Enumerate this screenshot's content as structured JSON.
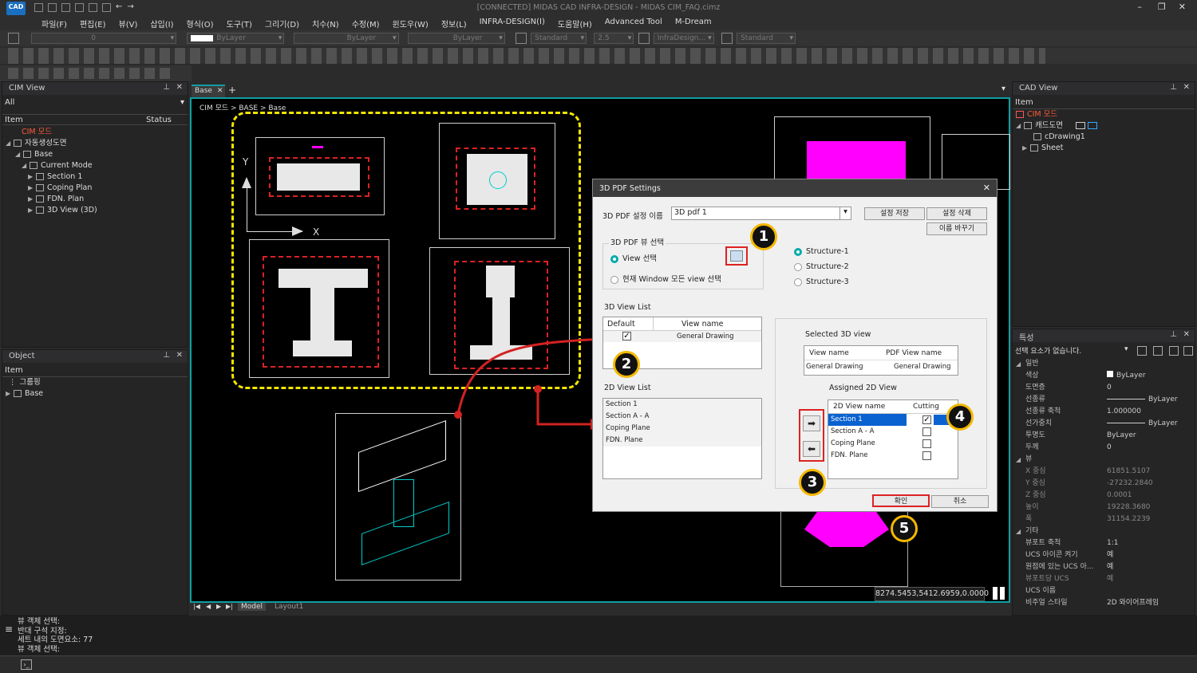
{
  "window": {
    "title": "[CONNECTED] MIDAS CAD INFRA-DESIGN - MIDAS CIM_FAQ.cimz",
    "logo": "CAD"
  },
  "menu": [
    "파일(F)",
    "편집(E)",
    "뷰(V)",
    "삽입(I)",
    "형식(O)",
    "도구(T)",
    "그리기(D)",
    "치수(N)",
    "수정(M)",
    "윈도우(W)",
    "정보(L)",
    "INFRA-DESIGN(I)",
    "도움말(H)",
    "Advanced Tool",
    "M-Dream"
  ],
  "toolbar": {
    "layer_value": "0",
    "color": "ByLayer",
    "linetype": "ByLayer",
    "lineweight": "ByLayer",
    "textstyle": "Standard",
    "size": "2.5",
    "dimstyle": "InfraDesign...",
    "mlstyle": "Standard"
  },
  "cim_view": {
    "title": "CIM View",
    "filter": "All",
    "col_item": "Item",
    "col_status": "Status",
    "root": "CIM 모드",
    "auto": "자동생성도면",
    "base": "Base",
    "mode": "Current Mode",
    "items": [
      "Section 1",
      "Coping Plan",
      "FDN. Plan",
      "3D View (3D)"
    ]
  },
  "object_panel": {
    "title": "Object",
    "col_item": "Item",
    "group": "그룹핑",
    "base": "Base"
  },
  "tabs": {
    "active": "Base"
  },
  "breadcrumb": "CIM 모드 > BASE > Base",
  "axis": {
    "y": "Y",
    "x": "X"
  },
  "dialog": {
    "title": "3D PDF Settings",
    "name_label": "3D PDF 설정 이름",
    "name_value": "3D pdf  1",
    "btn_save": "설정 저장",
    "btn_delete": "설정 삭제",
    "btn_rename": "이름 바꾸기",
    "view_group": "3D PDF 뷰 선택",
    "radio_view": "View 선택",
    "radio_all": "현재 Window 모든 view 선택",
    "structures": [
      "Structure-1",
      "Structure-2",
      "Structure-3"
    ],
    "list3d_title": "3D View List",
    "list3d_col_default": "Default",
    "list3d_col_name": "View name",
    "list3d_row": "General Drawing",
    "list2d_title": "2D View List",
    "list2d": [
      "Section 1",
      "Section A - A",
      "Coping Plane",
      "FDN. Plane"
    ],
    "selected_title": "Selected 3D view",
    "sel_col_view": "View name",
    "sel_col_pdf": "PDF View name",
    "sel_view": "General Drawing",
    "sel_pdf": "General Drawing",
    "assigned_title": "Assigned 2D View",
    "asg_col_name": "2D View name",
    "asg_col_cut": "Cutting",
    "assigned": [
      "Section 1",
      "Section A - A",
      "Coping Plane",
      "FDN. Plane"
    ],
    "ok": "확인",
    "cancel": "취소"
  },
  "badges": [
    "1",
    "2",
    "3",
    "4",
    "5"
  ],
  "layout_tabs": {
    "model": "Model",
    "layout1": "Layout1"
  },
  "coords": "8274.5453,5412.6959,0.0000",
  "cad_view": {
    "title": "CAD View",
    "col_item": "Item",
    "root": "CIM 모드",
    "cad": "캐드도면",
    "drawing": "cDrawing1",
    "sheet": "Sheet"
  },
  "properties": {
    "title": "특성",
    "none_selected": "선택 요소가 없습니다.",
    "sec_general": "일반",
    "sec_view": "뷰",
    "sec_other": "기타",
    "general": [
      [
        "색상",
        "ByLayer"
      ],
      [
        "도면층",
        "0"
      ],
      [
        "선종류",
        "ByLayer"
      ],
      [
        "선종류 축척",
        "1.000000"
      ],
      [
        "선가중치",
        "ByLayer"
      ],
      [
        "투명도",
        "ByLayer"
      ],
      [
        "두께",
        "0"
      ]
    ],
    "view": [
      [
        "X 중심",
        "61851.5107"
      ],
      [
        "Y 중심",
        "-27232.2840"
      ],
      [
        "Z 중심",
        "0.0001"
      ],
      [
        "높이",
        "19228.3680"
      ],
      [
        "폭",
        "31154.2239"
      ]
    ],
    "other": [
      [
        "뷰포트 축척",
        "1:1"
      ],
      [
        "UCS 아이콘 켜기",
        "예"
      ],
      [
        "원점에 있는 UCS 아...",
        "예"
      ],
      [
        "뷰포트당 UCS",
        "예"
      ],
      [
        "UCS 이름",
        ""
      ],
      [
        "비주얼 스타일",
        "2D 와이어프레임"
      ]
    ]
  },
  "command": [
    "뷰 객체 선택:",
    "반대 구석 지정:",
    "세트 내의 도면요소: 77",
    "뷰 객체 선택:"
  ],
  "colors": {
    "accent": "#0f9ea3",
    "badge": "#f5b800",
    "annot": "#d22222",
    "magenta": "#ff00ff"
  }
}
